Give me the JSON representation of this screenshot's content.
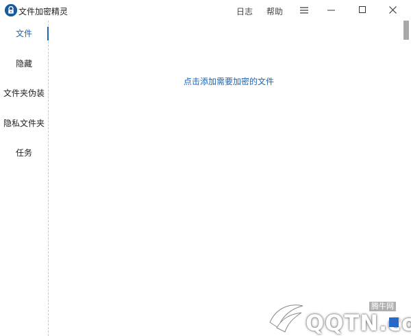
{
  "window": {
    "title": "文件加密精灵",
    "links": {
      "log": "日志",
      "help": "帮助"
    },
    "icons": {
      "app": "lock-icon",
      "menu": "hamburger-menu-icon",
      "minimize": "minimize-icon",
      "maximize": "maximize-icon",
      "close": "close-icon"
    }
  },
  "sidebar": {
    "items": [
      {
        "label": "文件",
        "active": true
      },
      {
        "label": "隐藏",
        "active": false
      },
      {
        "label": "文件夹伪装",
        "active": false
      },
      {
        "label": "隐私文件夹",
        "active": false
      },
      {
        "label": "任务",
        "active": false
      }
    ]
  },
  "main": {
    "add_files_link": "点击添加需要加密的文件"
  },
  "watermark": {
    "cn": "腾牛网",
    "en": "QQTN.com"
  },
  "colors": {
    "accent": "#1a64b4",
    "app_icon": "#1a5b9c",
    "divider": "#c8c8c8",
    "scroll_thumb": "#a8a8a8"
  }
}
